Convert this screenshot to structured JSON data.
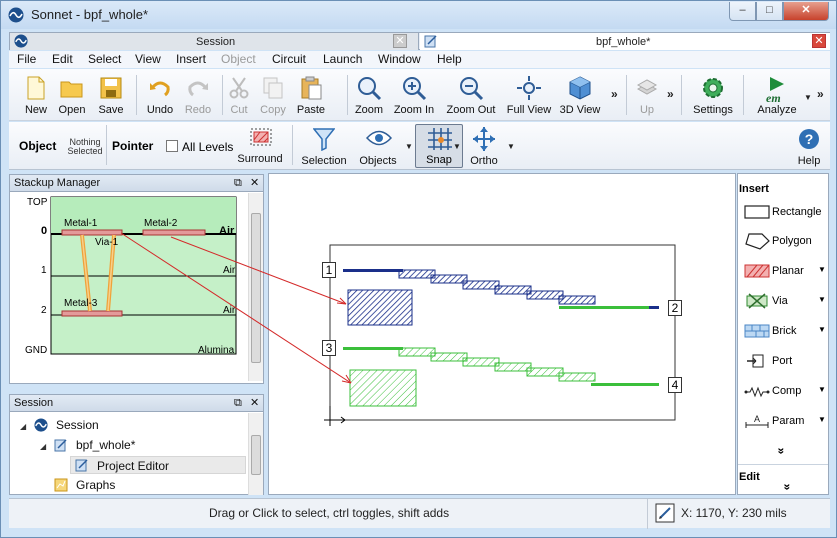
{
  "window": {
    "title": "Sonnet - bpf_whole*",
    "min": "–",
    "max": "□",
    "close": "✕"
  },
  "tabs": [
    {
      "label": "Session",
      "close": "✕"
    },
    {
      "label": "bpf_whole*",
      "close": "✕"
    }
  ],
  "menu": [
    "File",
    "Edit",
    "Select",
    "View",
    "Insert",
    "Object",
    "Circuit",
    "Launch",
    "Window",
    "Help"
  ],
  "toolbar": {
    "new": "New",
    "open": "Open",
    "save": "Save",
    "undo": "Undo",
    "redo": "Redo",
    "cut": "Cut",
    "copy": "Copy",
    "paste": "Paste",
    "zoom": "Zoom",
    "zoom_in": "Zoom In",
    "zoom_out": "Zoom Out",
    "full_view": "Full View",
    "view_3d": "3D View",
    "up": "Up",
    "settings": "Settings",
    "analyze": "Analyze",
    "more": "»",
    "analyze_icon_text": "em"
  },
  "toolbar2": {
    "object_label": "Object",
    "nothing_selected_1": "Nothing",
    "nothing_selected_2": "Selected",
    "pointer_label": "Pointer",
    "all_levels": "All Levels",
    "surround": "Surround",
    "selection": "Selection",
    "objects": "Objects",
    "snap": "Snap",
    "ortho": "Ortho",
    "help": "Help",
    "dropdown_arrow": "▼"
  },
  "stackup": {
    "title": "Stackup Manager",
    "levels": [
      "TOP",
      "0",
      "1",
      "2",
      "GND"
    ],
    "metals": [
      "Metal-1",
      "Metal-2",
      "Metal-3"
    ],
    "via": "Via-1",
    "dielectrics": [
      "Air",
      "Air",
      "Air",
      "Alumina"
    ],
    "float_icon": "⧉",
    "close_icon": "✕"
  },
  "session": {
    "title": "Session",
    "items": [
      "Session",
      "bpf_whole*",
      "Project Editor",
      "Graphs"
    ],
    "float_icon": "⧉",
    "close_icon": "✕"
  },
  "canvas": {
    "ports": [
      "1",
      "2",
      "3",
      "4"
    ]
  },
  "insert_panel": {
    "title": "Insert",
    "items": [
      "Rectangle",
      "Polygon",
      "Planar",
      "Via",
      "Brick",
      "Port",
      "Comp",
      "Param"
    ],
    "more": "»",
    "edit_title": "Edit",
    "dropdown_arrow": "▼"
  },
  "status": {
    "message": "Drag or Click to select, ctrl toggles, shift adds",
    "coords": "X: 1170, Y: 230 mils"
  }
}
